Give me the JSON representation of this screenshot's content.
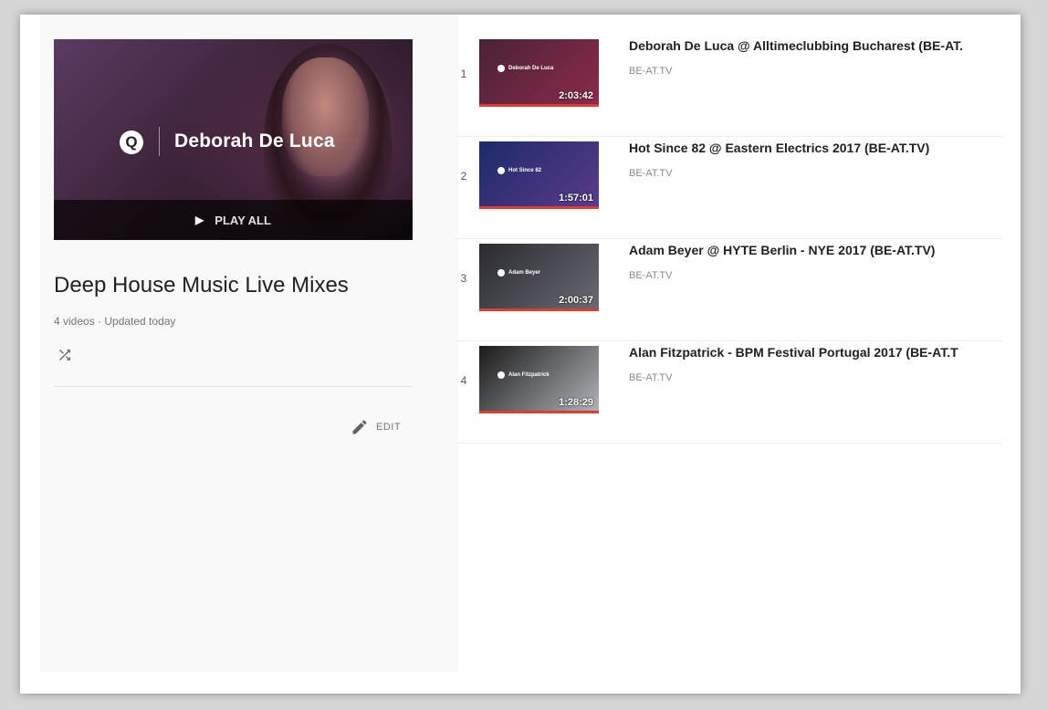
{
  "hero": {
    "artist": "Deborah De Luca",
    "play_all_label": "PLAY ALL",
    "brand_icon": "be-at-logo-icon"
  },
  "playlist": {
    "title": "Deep House Music Live Mixes",
    "meta": "4 videos · Updated today",
    "edit_label": "EDIT"
  },
  "videos": [
    {
      "index": "1",
      "title": "Deborah De Luca @ Alltimeclubbing Bucharest (BE-AT.",
      "channel": "BE-AT.TV",
      "duration": "2:03:42",
      "thumb_text": "Deborah De Luca",
      "colors": [
        "#4a2238",
        "#8c2a4a"
      ]
    },
    {
      "index": "2",
      "title": "Hot Since 82 @ Eastern Electrics 2017 (BE-AT.TV)",
      "channel": "BE-AT.TV",
      "duration": "1:57:01",
      "thumb_text": "Hot Since 82",
      "colors": [
        "#1c2b6a",
        "#5c3a8c"
      ]
    },
    {
      "index": "3",
      "title": "Adam Beyer @ HYTE Berlin - NYE 2017 (BE-AT.TV)",
      "channel": "BE-AT.TV",
      "duration": "2:00:37",
      "thumb_text": "Adam Beyer",
      "colors": [
        "#2a2a30",
        "#6a6a74"
      ]
    },
    {
      "index": "4",
      "title": "Alan Fitzpatrick - BPM Festival Portugal 2017 (BE-AT.T",
      "channel": "BE-AT.TV",
      "duration": "1:28:29",
      "thumb_text": "Alan Fitzpatrick",
      "colors": [
        "#1a1a1a",
        "#b0b3b8"
      ]
    }
  ]
}
